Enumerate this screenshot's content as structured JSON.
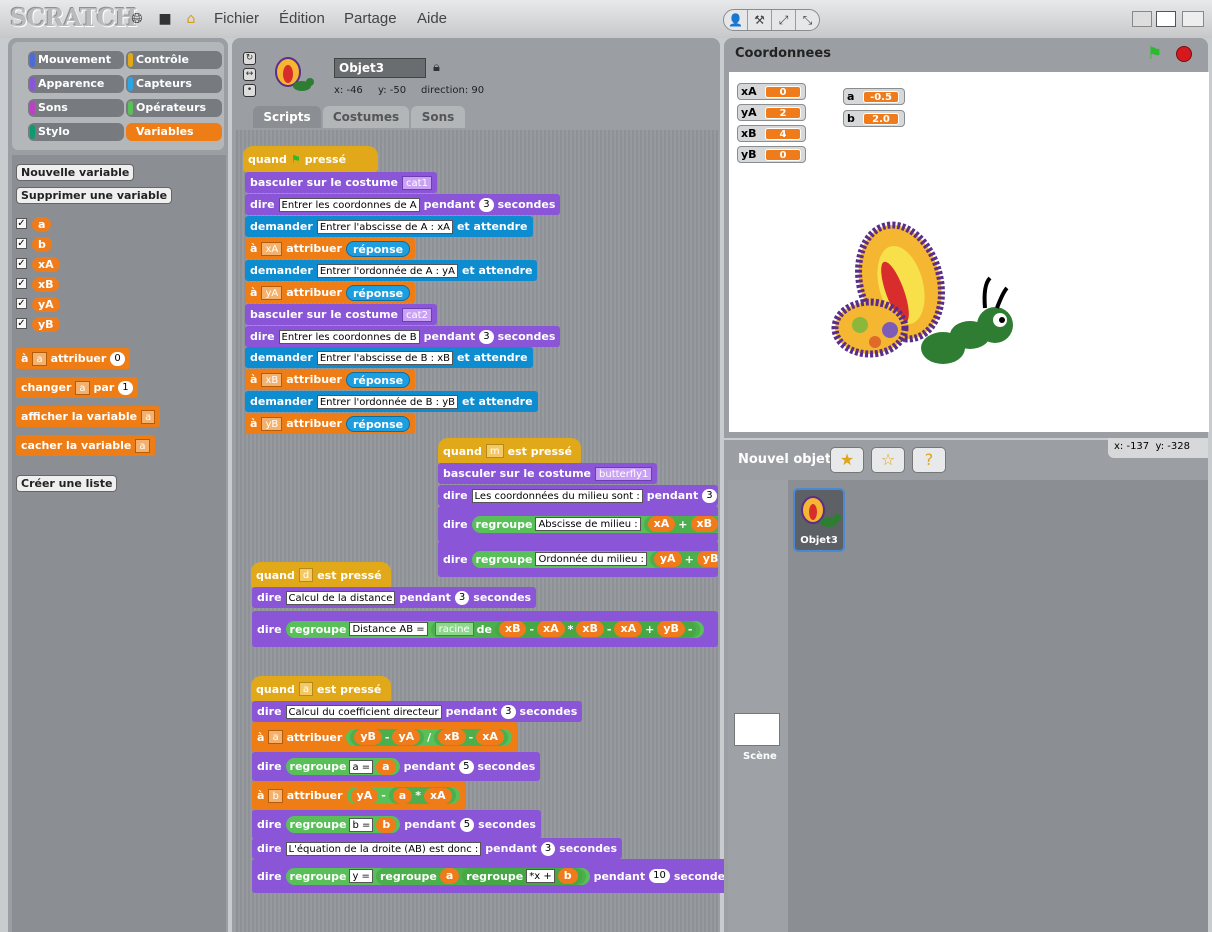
{
  "topbar": {
    "logo": "SCRATCH",
    "menus": [
      "Fichier",
      "Édition",
      "Partage",
      "Aide"
    ],
    "modes": [
      "👤",
      "⚒",
      "⤢",
      "⤡"
    ]
  },
  "categories": [
    {
      "label": "Mouvement",
      "color": "#4a6cd4"
    },
    {
      "label": "Contrôle",
      "color": "#e1a91a"
    },
    {
      "label": "Apparence",
      "color": "#8a55d7"
    },
    {
      "label": "Capteurs",
      "color": "#2ca5e2"
    },
    {
      "label": "Sons",
      "color": "#bb42c3"
    },
    {
      "label": "Opérateurs",
      "color": "#59c059"
    },
    {
      "label": "Stylo",
      "color": "#0e9a6c"
    },
    {
      "label": "Variables",
      "color": "#ee7d16"
    }
  ],
  "palette": {
    "new_var": "Nouvelle variable",
    "del_var": "Supprimer une variable",
    "vars": [
      "a",
      "b",
      "xA",
      "xB",
      "yA",
      "yB"
    ],
    "set": "à",
    "set_var": "a",
    "set_to": "attribuer",
    "set_val": "0",
    "change": "changer",
    "change_var": "a",
    "change_by": "par",
    "change_val": "1",
    "show": "afficher la variable",
    "show_var": "a",
    "hide": "cacher la variable",
    "hide_var": "a",
    "new_list": "Créer une liste"
  },
  "sprite": {
    "name": "Objet3",
    "x": "x: -46",
    "y": "y: -50",
    "dir": "direction: 90"
  },
  "tabs": [
    "Scripts",
    "Costumes",
    "Sons"
  ],
  "s1": {
    "hat": "quand",
    "hat2": "pressé",
    "b1": "basculer sur le costume",
    "b1c": "cat1",
    "b2": "dire",
    "b2t": "Entrer les coordonnes de A",
    "b2p": "pendant",
    "b2n": "3",
    "b2s": "secondes",
    "b3": "demander",
    "b3t": "Entrer l'abscisse de A : xA",
    "b3e": "et attendre",
    "b4": "à",
    "b4v": "xA",
    "b4a": "attribuer",
    "b4r": "réponse",
    "b5": "demander",
    "b5t": "Entrer l'ordonnée de A : yA",
    "b5e": "et attendre",
    "b6": "à",
    "b6v": "yA",
    "b6a": "attribuer",
    "b6r": "réponse",
    "b7": "basculer sur le costume",
    "b7c": "cat2",
    "b8": "dire",
    "b8t": "Entrer les coordonnes de B",
    "b8p": "pendant",
    "b8n": "3",
    "b8s": "secondes",
    "b9": "demander",
    "b9t": "Entrer l'abscisse de B : xB",
    "b9e": "et attendre",
    "b10": "à",
    "b10v": "xB",
    "b10a": "attribuer",
    "b10r": "réponse",
    "b11": "demander",
    "b11t": "Entrer l'ordonnée de B : yB",
    "b11e": "et attendre",
    "b12": "à",
    "b12v": "yB",
    "b12a": "attribuer",
    "b12r": "réponse"
  },
  "s2": {
    "hat": "quand",
    "key": "m",
    "hat2": "est pressé",
    "b1": "basculer sur le costume",
    "b1c": "butterfly1",
    "b2": "dire",
    "b2t": "Les coordonnées du milieu sont :",
    "b2p": "pendant",
    "b2n": "3",
    "b2s": "se",
    "b3": "dire",
    "b3j": "regroupe",
    "b3t": "Abscisse de milieu :",
    "b3a": "xA",
    "b3o": "+",
    "b3b": "xB",
    "b3x": "/",
    "b4": "dire",
    "b4j": "regroupe",
    "b4t": "Ordonnée du milieu :",
    "b4a": "yA",
    "b4o": "+",
    "b4b": "yB"
  },
  "s3": {
    "hat": "quand",
    "key": "d",
    "hat2": "est pressé",
    "b1": "dire",
    "b1t": "Calcul de la distance",
    "b1p": "pendant",
    "b1n": "3",
    "b1s": "secondes",
    "b2": "dire",
    "b2j": "regroupe",
    "b2t": "Distance AB =",
    "b2f": "racine",
    "b2d": "de",
    "b2v1": "xB",
    "b2m1": "-",
    "b2v2": "xA",
    "b2x": "*",
    "b2v3": "xB",
    "b2m2": "-",
    "b2v4": "xA",
    "b2p": "+",
    "b2v5": "yB",
    "b2m3": "-"
  },
  "s4": {
    "hat": "quand",
    "key": "a",
    "hat2": "est pressé",
    "b1": "dire",
    "b1t": "Calcul du coefficient directeur",
    "b1p": "pendant",
    "b1n": "3",
    "b1s": "secondes",
    "b2": "à",
    "b2v": "a",
    "b2a": "attribuer",
    "b2x1": "yB",
    "b2m1": "-",
    "b2x2": "yA",
    "b2d": "/",
    "b2x3": "xB",
    "b2m2": "-",
    "b2x4": "xA",
    "b3": "dire",
    "b3j": "regroupe",
    "b3t": "a =",
    "b3v": "a",
    "b3p": "pendant",
    "b3n": "5",
    "b3s": "secondes",
    "b4": "à",
    "b4v": "b",
    "b4a": "attribuer",
    "b4x1": "yA",
    "b4m": "-",
    "b4x2": "a",
    "b4t": "*",
    "b4x3": "xA",
    "b5": "dire",
    "b5j": "regroupe",
    "b5t": "b =",
    "b5v": "b",
    "b5p": "pendant",
    "b5n": "5",
    "b5s": "secondes",
    "b6": "dire",
    "b6t": "L'équation de la droite (AB) est donc :",
    "b6p": "pendant",
    "b6n": "3",
    "b6s": "secondes",
    "b7": "dire",
    "b7j": "regroupe",
    "b7t": "y =",
    "b7j2": "regroupe",
    "b7v": "a",
    "b7j3": "regroupe",
    "b7t2": "*x +",
    "b7v2": "b",
    "b7p": "pendant",
    "b7n": "10",
    "b7s": "secondes"
  },
  "stage": {
    "title": "Coordonnees",
    "monitors": [
      {
        "name": "xA",
        "value": "0"
      },
      {
        "name": "yA",
        "value": "2"
      },
      {
        "name": "xB",
        "value": "4"
      },
      {
        "name": "yB",
        "value": "0"
      }
    ],
    "monitors2": [
      {
        "name": "a",
        "value": "-0.5"
      },
      {
        "name": "b",
        "value": "2.0"
      }
    ],
    "mouse_x": "x: -137",
    "mouse_y": "y: -328"
  },
  "sprites": {
    "new_label": "Nouvel objet",
    "sprite_name": "Objet3",
    "scene_label": "Scène"
  }
}
